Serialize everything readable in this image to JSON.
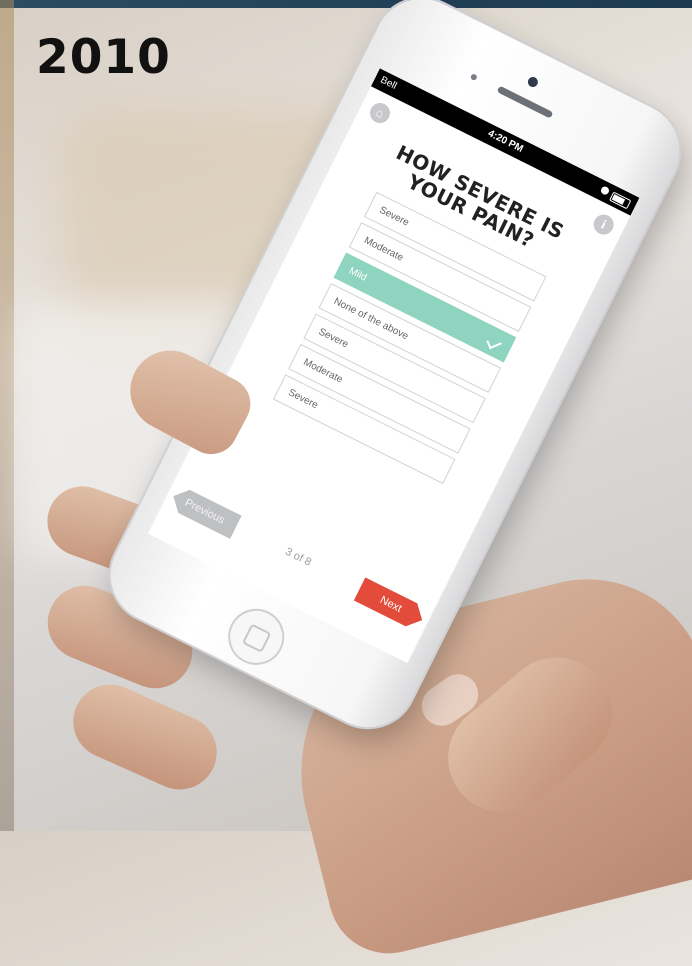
{
  "slide": {
    "year": "2010"
  },
  "status_bar": {
    "carrier": "Bell",
    "time": "4:20 PM"
  },
  "survey": {
    "question": "HOW SEVERE IS YOUR PAIN?",
    "options": [
      {
        "label": "Severe",
        "selected": false
      },
      {
        "label": "Moderate",
        "selected": false
      },
      {
        "label": "Mild",
        "selected": true
      },
      {
        "label": "None of the above",
        "selected": false
      },
      {
        "label": "Severe",
        "selected": false
      },
      {
        "label": "Moderate",
        "selected": false
      },
      {
        "label": "Severe",
        "selected": false
      }
    ],
    "page_indicator": "3 of 8",
    "previous_label": "Previous",
    "next_label": "Next"
  },
  "icons": {
    "home": "home-icon",
    "info": "info-icon",
    "check": "check-icon",
    "battery": "battery-icon"
  },
  "colors": {
    "selected_option": "#8fd4bf",
    "next_button": "#e34b3a",
    "previous_button": "#bfc0c2"
  }
}
